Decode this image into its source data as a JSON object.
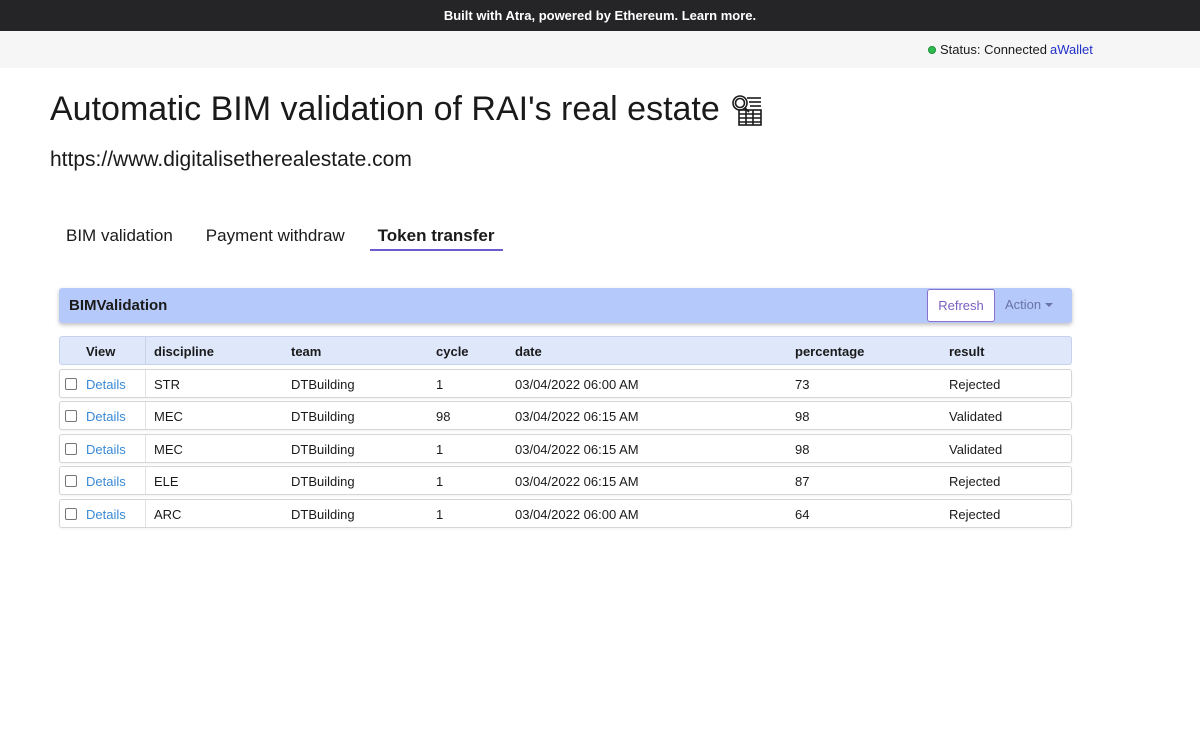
{
  "banner": {
    "text": "Built with Atra, powered by Ethereum. Learn more."
  },
  "statusbar": {
    "status": "Status: Connected",
    "wallet": "aWallet",
    "status_color": "#2fbd4f"
  },
  "header": {
    "title": "Automatic BIM validation of RAI's real estate",
    "title_icon": "building-search-icon",
    "url": "https://www.digitalisetherealestate.com"
  },
  "tabs": [
    {
      "label": "BIM validation",
      "active": false
    },
    {
      "label": "Payment withdraw",
      "active": false
    },
    {
      "label": "Token transfer",
      "active": true
    }
  ],
  "panel": {
    "title": "BIMValidation",
    "refresh_label": "Refresh",
    "action_label": "Action",
    "accent": "#b5c9fb"
  },
  "table": {
    "columns": [
      "View",
      "discipline",
      "team",
      "cycle",
      "date",
      "percentage",
      "result"
    ],
    "rows": [
      {
        "view": "Details",
        "discipline": "STR",
        "team": "DTBuilding",
        "cycle": "1",
        "date": "03/04/2022 06:00 AM",
        "percentage": "73",
        "result": "Rejected"
      },
      {
        "view": "Details",
        "discipline": "MEC",
        "team": "DTBuilding",
        "cycle": "98",
        "date": "03/04/2022 06:15 AM",
        "percentage": "98",
        "result": "Validated"
      },
      {
        "view": "Details",
        "discipline": "MEC",
        "team": "DTBuilding",
        "cycle": "1",
        "date": "03/04/2022 06:15 AM",
        "percentage": "98",
        "result": "Validated"
      },
      {
        "view": "Details",
        "discipline": "ELE",
        "team": "DTBuilding",
        "cycle": "1",
        "date": "03/04/2022 06:15 AM",
        "percentage": "87",
        "result": "Rejected"
      },
      {
        "view": "Details",
        "discipline": "ARC",
        "team": "DTBuilding",
        "cycle": "1",
        "date": "03/04/2022 06:00 AM",
        "percentage": "64",
        "result": "Rejected"
      }
    ]
  }
}
